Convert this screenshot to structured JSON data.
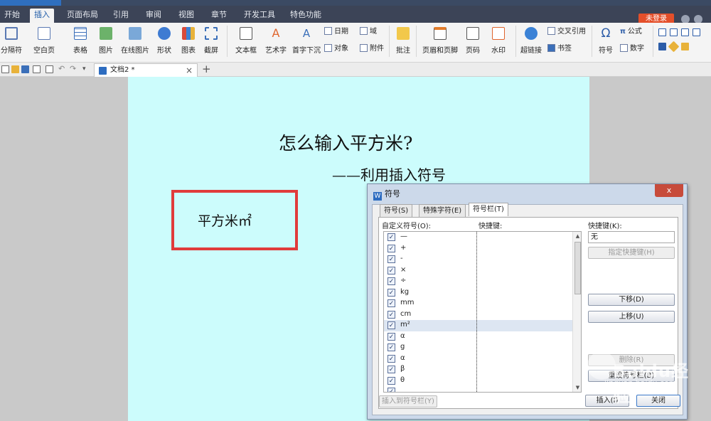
{
  "menu": {
    "items": [
      "开始",
      "插入",
      "页面布局",
      "引用",
      "审阅",
      "视图",
      "章节",
      "开发工具",
      "特色功能"
    ],
    "active_index": 1,
    "login": "未登录"
  },
  "ribbon": {
    "big_buttons": [
      "分隔符",
      "空白页",
      "表格",
      "图片",
      "在线图片",
      "形状",
      "图表",
      "截屏",
      "文本框",
      "艺术字",
      "首字下沉",
      "批注",
      "页眉和页脚",
      "页码",
      "水印",
      "超链接",
      "符号",
      "公式",
      "数字"
    ],
    "small_buttons": [
      "日期",
      "域",
      "对象",
      "附件",
      "交叉引用",
      "书签"
    ]
  },
  "document_tab": {
    "name": "文档2 *"
  },
  "document": {
    "title": "怎么输入平方米?",
    "subtitle": "——利用插入符号",
    "sample": "平方米㎡"
  },
  "dialog": {
    "title": "符号",
    "close": "x",
    "tabs": [
      "符号(S)",
      "特殊字符(E)",
      "符号栏(T)"
    ],
    "active_tab": 2,
    "custom_symbols_header": "自定义符号(O):",
    "shortcut_header": "快捷键:",
    "symbols": [
      "—",
      "+",
      "-",
      "×",
      "÷",
      "kg",
      "mm",
      "cm",
      "m²",
      "α",
      "g",
      "α",
      "β",
      "θ"
    ],
    "selected_index": 8,
    "shortcut_key_label": "快捷键(K):",
    "shortcut_key_value": "无",
    "assign_shortcut": "指定快捷键(H)",
    "move_down": "下移(D)",
    "move_up": "上移(U)",
    "delete": "删除(R)",
    "reset_bar": "重设符号栏(B)",
    "insert_to_bar": "插入到符号栏(Y)",
    "insert": "插入(I)",
    "close_button": "关闭"
  },
  "watermark": {
    "brand": "Baidu经验",
    "url": "jingyan.baidu.com"
  },
  "colors": {
    "page_bg": "#ccfcfc",
    "highlight_border": "#e03b3b",
    "menu_bg": "#3c4457",
    "login_bg": "#e44f2a"
  }
}
